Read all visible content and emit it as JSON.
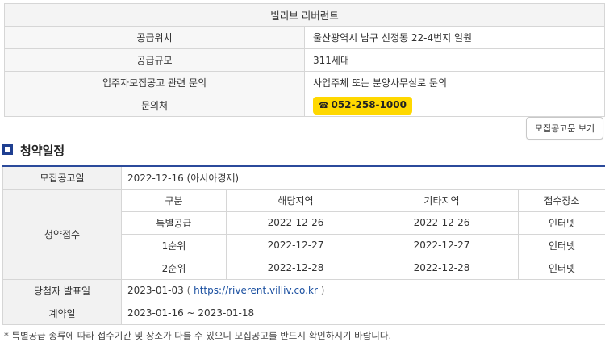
{
  "info": {
    "title": "빌리브 리버런트",
    "rows": [
      {
        "label": "공급위치",
        "value": "울산광역시 남구 신정동 22-4번지 일원"
      },
      {
        "label": "공급규모",
        "value": "311세대"
      },
      {
        "label": "입주자모집공고 관련 문의",
        "value": "사업주체 또는 분양사무실로 문의"
      },
      {
        "label": "문의처",
        "value": "052-258-1000"
      }
    ],
    "phone_icon": "☎"
  },
  "notice_button_label": "모집공고문 보기",
  "section_title": "청약일정",
  "schedule": {
    "announce_label": "모집공고일",
    "announce_value": "2022-12-16 (아시아경제)",
    "apply_label": "청약접수",
    "headers": [
      "구분",
      "해당지역",
      "기타지역",
      "접수장소"
    ],
    "rows": [
      {
        "type": "특별공급",
        "local": "2022-12-26",
        "other": "2022-12-26",
        "place": "인터넷"
      },
      {
        "type": "1순위",
        "local": "2022-12-27",
        "other": "2022-12-27",
        "place": "인터넷"
      },
      {
        "type": "2순위",
        "local": "2022-12-28",
        "other": "2022-12-28",
        "place": "인터넷"
      }
    ],
    "winner_label": "당첨자 발표일",
    "winner_date": "2023-01-03",
    "winner_open": "(",
    "winner_link": "https://riverent.villiv.co.kr",
    "winner_close": ")",
    "contract_label": "계약일",
    "contract_value": "2023-01-16 ~ 2023-01-18"
  },
  "footnote": "* 특별공급 종류에 따라 접수기간 및 장소가 다를 수 있으니 모집공고를 반드시 확인하시기 바랍니다."
}
